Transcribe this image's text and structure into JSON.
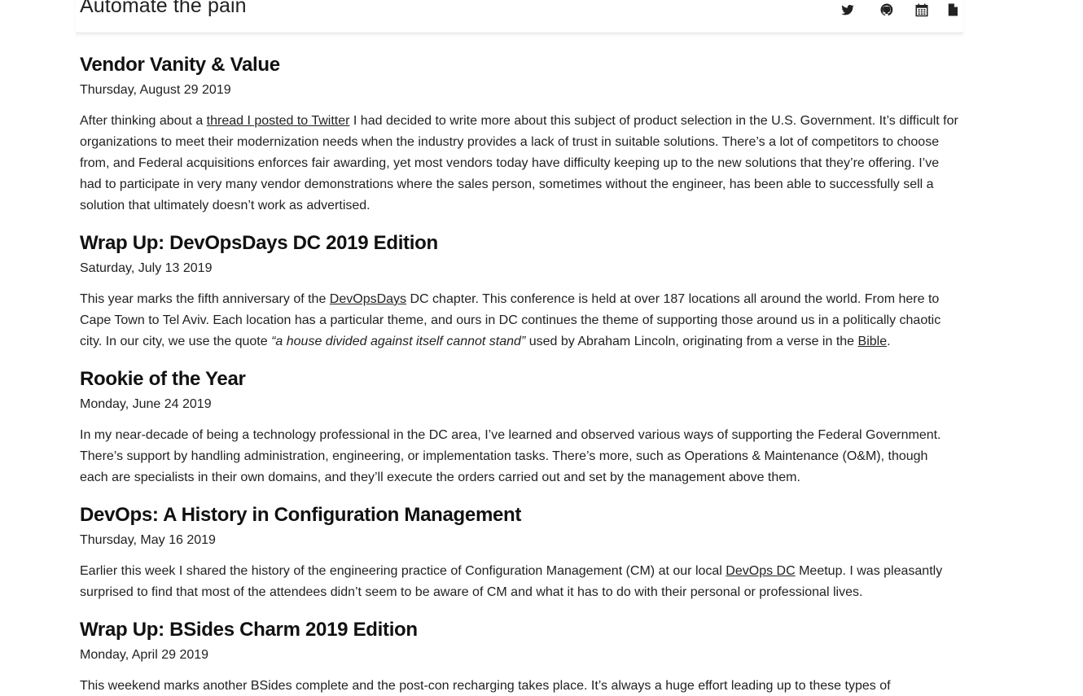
{
  "site": {
    "title": "Automate the pain"
  },
  "nav": {
    "icons": [
      "twitter-icon",
      "github-icon",
      "calendar-icon",
      "document-icon"
    ]
  },
  "posts": [
    {
      "title": "Vendor Vanity & Value",
      "date": "Thursday, August 29 2019",
      "excerpt_before_link": "After thinking about a ",
      "link_text": "thread I posted to Twitter",
      "excerpt_after_link": " I had decided to write more about this subject of product selection in the U.S. Government. It’s difficult for organizations to meet their modernization needs when the industry provides a lack of trust in suitable solutions. There’s a lot of competitors to choose from, and Federal acquisitions enforces fair awarding, yet most vendors today have difficulty keeping up to the new solutions that they’re offering. I’ve had to participate in very many vendor demonstrations where the sales person, sometimes without the engineer, has been able to successfully sell a solution that ultimately doesn’t work as advertised."
    },
    {
      "title": "Wrap Up: DevOpsDays DC 2019 Edition",
      "date": "Saturday, July 13 2019",
      "excerpt_before_link": "This year marks the fifth anniversary of the ",
      "link_text": "DevOpsDays",
      "excerpt_middle": " DC chapter. This conference is held at over 187 locations all around the world. From here to Cape Town to Tel Aviv. Each location has a particular theme, and ours in DC continues the theme of supporting those around us in a politically chaotic city. In our city, we use the quote ",
      "quote": "“a house divided against itself cannot stand”",
      "excerpt_after_quote": " used by Abraham Lincoln, originating from a verse in the ",
      "link2_text": "Bible",
      "excerpt_end": "."
    },
    {
      "title": "Rookie of the Year",
      "date": "Monday, June 24 2019",
      "excerpt": "In my near-decade of being a technology professional in the DC area, I’ve learned and observed various ways of supporting the Federal Government. There’s support by handling administration, engineering, or implementation tasks. There’s more, such as Operations & Maintenance (O&M), though each are specialists in their own domains, and they’ll execute the orders carried out and set by the management above them."
    },
    {
      "title": "DevOps: A History in Configuration Management",
      "date": "Thursday, May 16 2019",
      "excerpt_before_link": "Earlier this week I shared the history of the engineering practice of Configuration Management (CM) at our local ",
      "link_text": "DevOps DC",
      "excerpt_after_link": " Meetup. I was pleasantly surprised to find that most of the attendees didn’t seem to be aware of CM and what it has to do with their personal or professional lives."
    },
    {
      "title": "Wrap Up: BSides Charm 2019 Edition",
      "date": "Monday, April 29 2019",
      "excerpt": "This weekend marks another BSides complete and the post-con recharging takes place. It’s always a huge effort leading up to these types of"
    }
  ]
}
